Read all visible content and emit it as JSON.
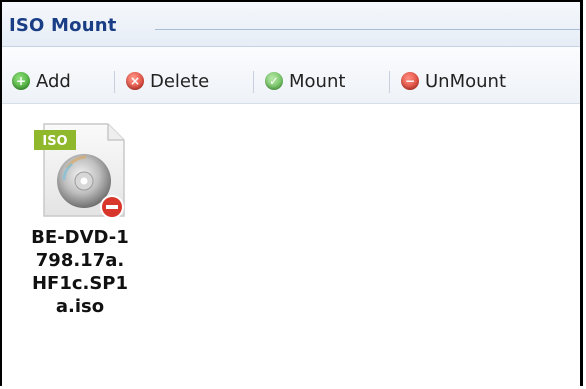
{
  "panel": {
    "title": "ISO Mount"
  },
  "toolbar": {
    "add_label": "Add",
    "delete_label": "Delete",
    "mount_label": "Mount",
    "unmount_label": "UnMount",
    "icons": {
      "add": "add-icon",
      "delete": "delete-icon",
      "mount": "mount-icon",
      "unmount": "unmount-icon"
    }
  },
  "files": [
    {
      "badge": "ISO",
      "name": "BE-DVD-1\n798.17a.\nHF1c.SP1\na.iso",
      "status": "unmounted",
      "icon": "iso-file-icon"
    }
  ],
  "colors": {
    "title": "#1a3e85",
    "badge": "#8fb82c",
    "unmounted_badge": "#d9362b"
  }
}
